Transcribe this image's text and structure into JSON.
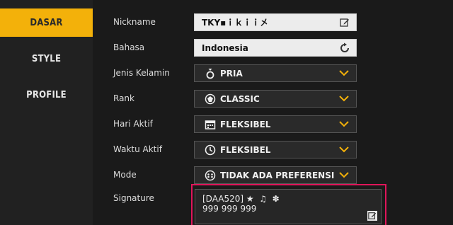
{
  "sidebar": {
    "items": [
      {
        "label": "DASAR",
        "active": true
      },
      {
        "label": "STYLE",
        "active": false
      },
      {
        "label": "PROFILE",
        "active": false
      }
    ]
  },
  "form": {
    "nickname": {
      "label": "Nickname",
      "value": "TKY▪ｉｋｉｉ㐅",
      "icon": "edit-icon"
    },
    "language": {
      "label": "Bahasa",
      "value": "Indonesia",
      "icon": "refresh-icon"
    },
    "gender": {
      "label": "Jenis Kelamin",
      "value": "PRIA",
      "icon": "male-icon"
    },
    "rank": {
      "label": "Rank",
      "value": "CLASSIC",
      "icon": "rank-badge-icon"
    },
    "active_days": {
      "label": "Hari Aktif",
      "value": "FLEKSIBEL",
      "icon": "calendar-icon"
    },
    "active_time": {
      "label": "Waktu Aktif",
      "value": "FLEKSIBEL",
      "icon": "clock-icon"
    },
    "mode": {
      "label": "Mode",
      "value": "TIDAK ADA PREFERENSI",
      "icon": "gamepad-icon"
    },
    "signature": {
      "label": "Signature",
      "line1": "[DAA520] ★  ♫  ✽",
      "line2": "999 999 999"
    }
  },
  "colors": {
    "accent": "#f3b10a",
    "highlight": "#e0155a",
    "chevron": "#f3b10a"
  }
}
